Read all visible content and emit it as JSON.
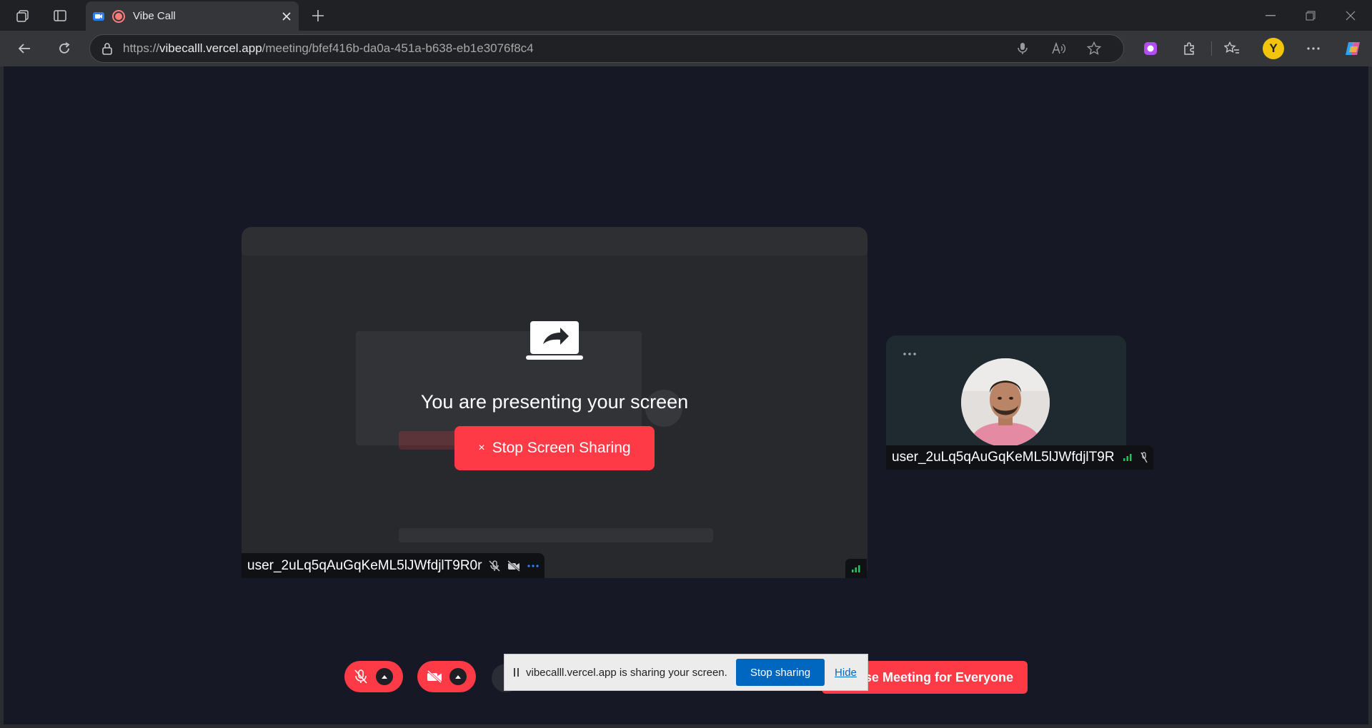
{
  "browser": {
    "tab_title": "Vibe Call",
    "url_prefix": "https://",
    "url_host": "vibecalll.vercel.app",
    "url_path": "/meeting/bfef416b-da0a-451a-b638-eb1e3076f8c4",
    "profile_initial": "Y"
  },
  "meeting": {
    "presenting_text": "You are presenting your screen",
    "stop_share_icon": "×",
    "stop_share_label": "Stop Screen Sharing",
    "share_tile_user": "user_2uLq5qAuGqKeML5lJWfdjlT9R0r",
    "participant_user": "user_2uLq5qAuGqKeML5lJWfdjlT9R",
    "end_meeting_label": "se Meeting for Everyone",
    "accent_color": "#ff3a47",
    "signal_color": "#21c35e"
  },
  "share_banner": {
    "message": "vibecalll.vercel.app is sharing your screen.",
    "stop_label": "Stop sharing",
    "hide_label": "Hide"
  }
}
